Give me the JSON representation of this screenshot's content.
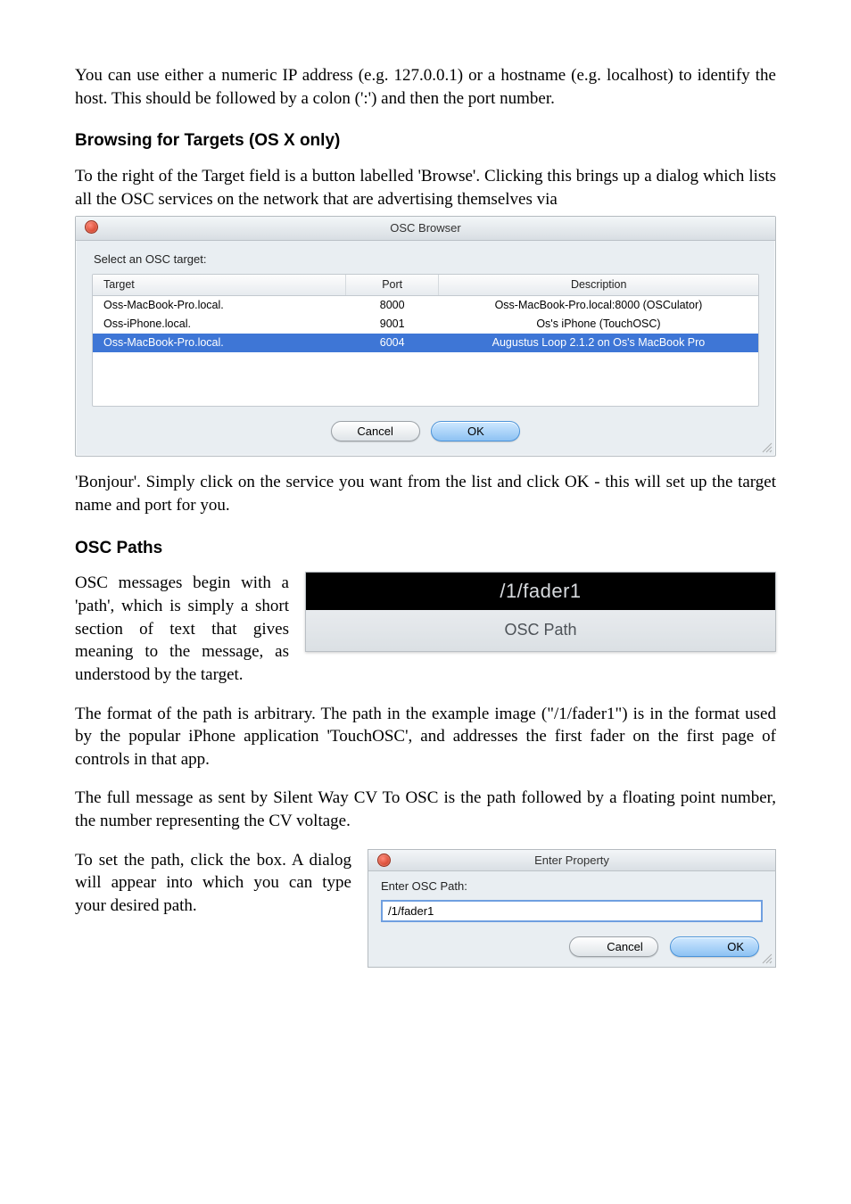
{
  "paragraphs": {
    "intro1": "You can use either a numeric IP address (e.g. 127.0.0.1) or a hostname (e.g. localhost) to identify the host. This should be followed by a colon (':') and then the port number.",
    "intro2": "To the right of the Target field is a button labelled 'Browse'. Clicking this brings up a dialog which lists all the OSC services on the network that are advertising themselves via",
    "after_browser": "'Bonjour'. Simply click on the service you want from the list and click OK - this will set up the target name and port for you.",
    "osc_paths_p1": "OSC messages begin with a 'path', which is simply a short section of text that gives meaning to the message, as understood by the target.",
    "osc_paths_p2": "The format of the path is arbitrary. The path in the example image (\"/1/fader1\") is in the format used by the popular iPhone application 'TouchOSC', and addresses the first fader on the first page of controls in that app.",
    "osc_paths_p3": "The full message as sent by Silent Way CV To OSC is the path followed by a floating point number, the number representing the CV voltage.",
    "osc_paths_p4": "To set the path, click the box. A dialog will appear into which you can type your desired path."
  },
  "headings": {
    "browsing": "Browsing for Targets (OS X only)",
    "osc_paths": "OSC Paths"
  },
  "osc_browser": {
    "window_title": "OSC Browser",
    "prompt": "Select an OSC target:",
    "columns": {
      "c1": "Target",
      "c2": "Port",
      "c3": "Description"
    },
    "rows": [
      {
        "target": "Oss-MacBook-Pro.local.",
        "port": "8000",
        "desc": "Oss-MacBook-Pro.local:8000 (OSCulator)",
        "selected": false
      },
      {
        "target": "Oss-iPhone.local.",
        "port": "9001",
        "desc": "Os's iPhone (TouchOSC)",
        "selected": false
      },
      {
        "target": "Oss-MacBook-Pro.local.",
        "port": "6004",
        "desc": "Augustus Loop 2.1.2 on Os's MacBook Pro",
        "selected": true
      }
    ],
    "cancel": "Cancel",
    "ok": "OK"
  },
  "osc_path_box": {
    "value": "/1/fader1",
    "label": "OSC Path"
  },
  "enter_property": {
    "window_title": "Enter Property",
    "label": "Enter OSC Path:",
    "value": "/1/fader1",
    "cancel": "Cancel",
    "ok": "OK"
  }
}
